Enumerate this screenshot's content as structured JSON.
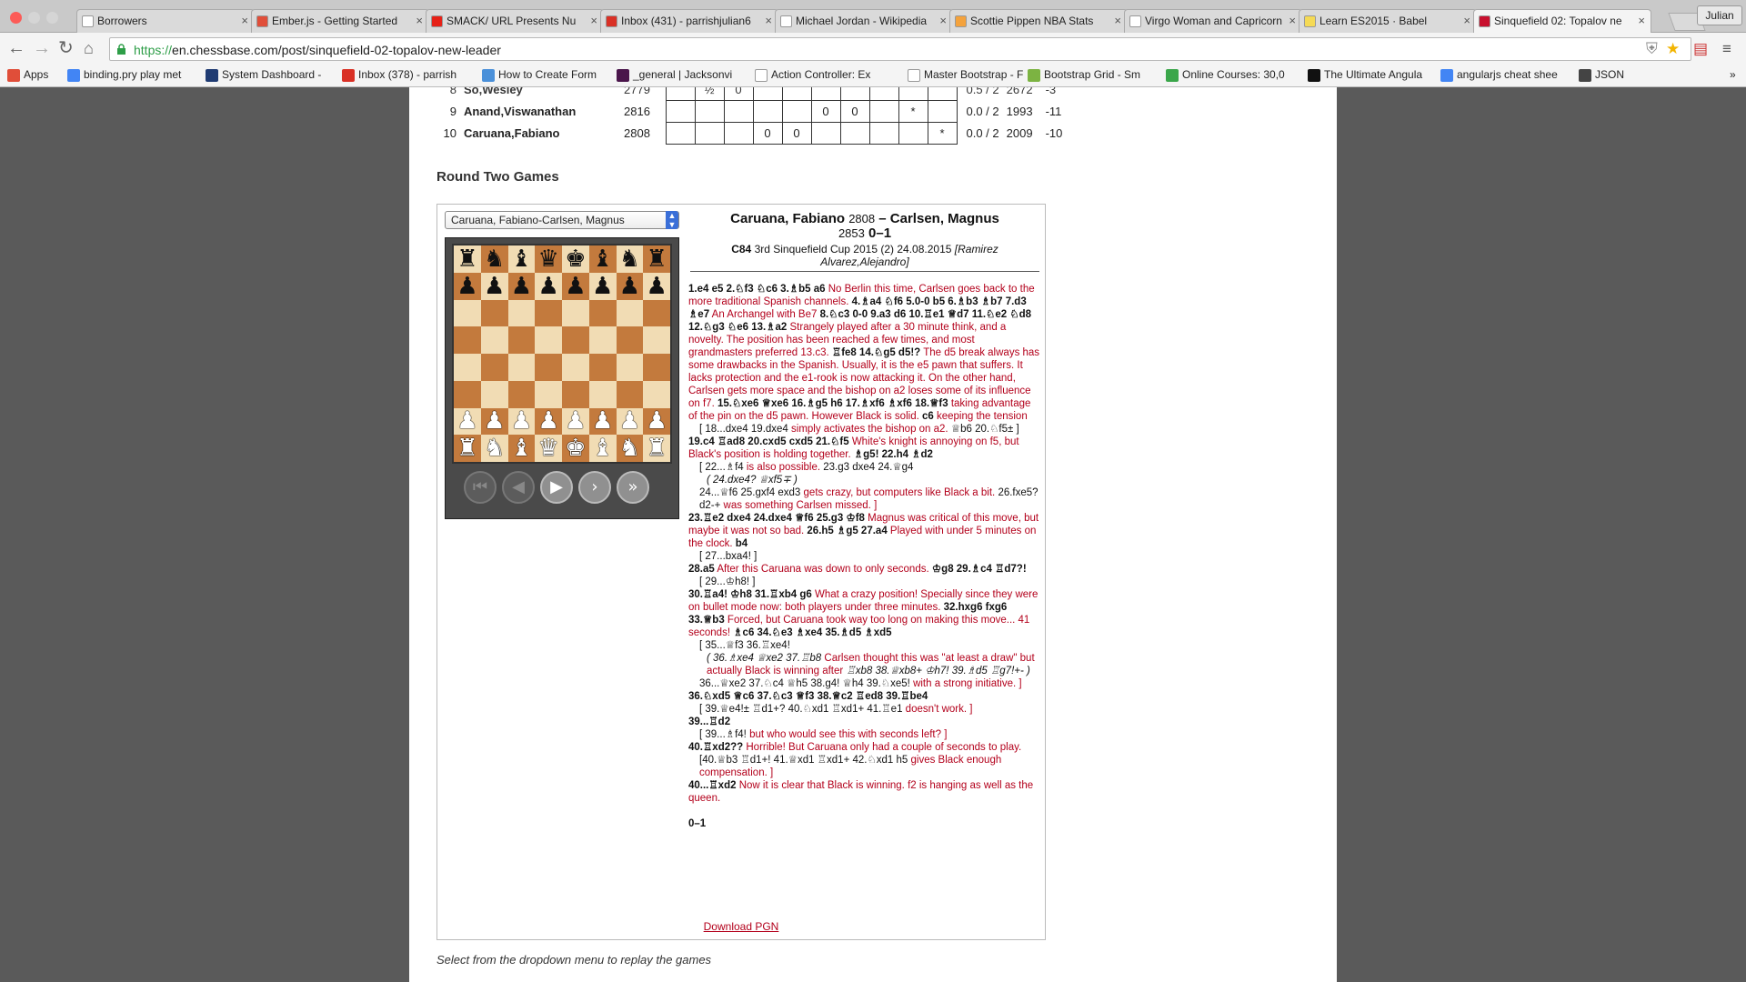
{
  "browser": {
    "tabs": [
      {
        "title": "Borrowers",
        "color": "#ffffff",
        "icon": "document-icon"
      },
      {
        "title": "Ember.js - Getting Started",
        "color": "#e04e39",
        "icon": "ember-icon"
      },
      {
        "title": "SMACK/ URL Presents Nu",
        "color": "#e62117",
        "icon": "youtube-icon"
      },
      {
        "title": "Inbox (431) - parrishjulian6",
        "color": "#d93025",
        "icon": "gmail-icon"
      },
      {
        "title": "Michael Jordan - Wikipedia",
        "color": "#ffffff",
        "icon": "wikipedia-icon"
      },
      {
        "title": "Scottie Pippen NBA Stats",
        "color": "#f4a23c",
        "icon": "basketball-icon"
      },
      {
        "title": "Virgo Woman and Capricorn",
        "color": "#ffffff",
        "icon": "document-icon"
      },
      {
        "title": "Learn ES2015 · Babel",
        "color": "#f5da55",
        "icon": "babel-icon"
      },
      {
        "title": "Sinquefield 02: Topalov ne",
        "color": "#c8102e",
        "icon": "chessbase-icon",
        "active": true
      }
    ],
    "profile_name": "Julian",
    "url_prefix": "https://",
    "url_rest": "en.chessbase.com/post/sinquefield-02-topalov-new-leader",
    "bookmarks": [
      {
        "label": "Apps",
        "color": "#e04e39",
        "icon": "apps-grid-icon"
      },
      {
        "label": "binding.pry play met",
        "color": "#4285f4",
        "icon": "google-icon"
      },
      {
        "label": "System Dashboard -",
        "color": "#1f3b73",
        "icon": "jira-icon"
      },
      {
        "label": "Inbox (378) - parrish",
        "color": "#d93025",
        "icon": "gmail-icon"
      },
      {
        "label": "How to Create Form",
        "color": "#4a90d9",
        "icon": "tutorial-icon"
      },
      {
        "label": "_general | Jacksonvi",
        "color": "#4a154b",
        "icon": "slack-icon"
      },
      {
        "label": "Action Controller: Ex",
        "color": "#ffffff",
        "icon": "document-icon"
      },
      {
        "label": "Master Bootstrap - F",
        "color": "#ffffff",
        "icon": "blank-icon"
      },
      {
        "label": "Bootstrap Grid - Sm",
        "color": "#7cb342",
        "icon": "grid-icon"
      },
      {
        "label": "Online Courses: 30,0",
        "color": "#3aa64a",
        "icon": "udemy-icon"
      },
      {
        "label": "The Ultimate Angula",
        "color": "#111111",
        "icon": "angular-icon"
      },
      {
        "label": "angularjs cheat shee",
        "color": "#4285f4",
        "icon": "google-icon"
      },
      {
        "label": "JSON",
        "color": "#444444",
        "icon": "json-icon"
      }
    ],
    "bookmarks_overflow": "»"
  },
  "standings": {
    "rows": [
      {
        "num": "8",
        "player": "So,Wesley",
        "elo": "2779",
        "cells": [
          "",
          "½",
          "0",
          "",
          "",
          "",
          "",
          "",
          "",
          ""
        ],
        "score": "0.5 / 2",
        "perf": "2672",
        "diff": "-3",
        "partial": true
      },
      {
        "num": "9",
        "player": "Anand,Viswanathan",
        "elo": "2816",
        "cells": [
          "",
          "",
          "",
          "",
          "",
          "0",
          "0",
          "",
          "*",
          ""
        ],
        "score": "0.0 / 2",
        "perf": "1993",
        "diff": "-11"
      },
      {
        "num": "10",
        "player": "Caruana,Fabiano",
        "elo": "2808",
        "cells": [
          "",
          "",
          "",
          "0",
          "0",
          "",
          "",
          "",
          "",
          "*"
        ],
        "score": "0.0 / 2",
        "perf": "2009",
        "diff": "-10"
      }
    ]
  },
  "section_title": "Round Two Games",
  "game": {
    "selector_value": "Caruana, Fabiano-Carlsen, Magnus",
    "white": "Caruana, Fabiano",
    "white_elo": "2808",
    "separator": "–",
    "black": "Carlsen, Magnus",
    "black_elo": "2853",
    "result": "0–1",
    "eco": "C84",
    "event": "3rd Sinquefield Cup 2015",
    "round": "(2)",
    "date": "24.08.2015",
    "annotator": "[Ramirez Alvarez,Alejandro]",
    "board": [
      [
        "♜",
        "♞",
        "♝",
        "♛",
        "♚",
        "♝",
        "♞",
        "♜"
      ],
      [
        "♟",
        "♟",
        "♟",
        "♟",
        "♟",
        "♟",
        "♟",
        "♟"
      ],
      [
        "",
        "",
        "",
        "",
        "",
        "",
        "",
        ""
      ],
      [
        "",
        "",
        "",
        "",
        "",
        "",
        "",
        ""
      ],
      [
        "",
        "",
        "",
        "",
        "",
        "",
        "",
        ""
      ],
      [
        "",
        "",
        "",
        "",
        "",
        "",
        "",
        ""
      ],
      [
        "♙",
        "♙",
        "♙",
        "♙",
        "♙",
        "♙",
        "♙",
        "♙"
      ],
      [
        "♖",
        "♘",
        "♗",
        "♕",
        "♔",
        "♗",
        "♘",
        "♖"
      ]
    ],
    "controls": [
      "|◀",
      "◀",
      "▶",
      "▶",
      "▶|"
    ],
    "download_label": "Download PGN",
    "final_result": "0–1"
  },
  "notation": [
    {
      "m": "1.e4  e5  2.♘f3  ♘c6  3.♗b5  a6",
      "c": " No Berlin this time, Carlsen goes back to the more traditional Spanish channels. ",
      "m2": "4.♗a4  ♘f6  5.0-0  b5  6.♗b3  ♗b7  7.d3  ♗e7",
      "c2": " An Archangel with Be7 ",
      "m3": "8.♘c3  0-0  9.a3  d6  10.♖e1  ♕d7  11.♘e2  ♘d8  12.♘g3  ♘e6  13.♗a2",
      "c3": " Strangely played after a 30 minute think, and a novelty. The position has been reached a few times, and most grandmasters preferred 13.c3. ",
      "m4": "♖fe8  14.♘g5  d5!?",
      "c4": " The d5 break always has some drawbacks in the Spanish. Usually, it is the e5 pawn that suffers. It lacks protection and the e1-rook is now attacking it. On the other hand, Carlsen gets more space and the bishop on a2 loses some of its influence on f7. ",
      "m5": "15.♘xe6  ♕xe6  16.♗g5  h6  17.♗xf6  ♗xf6  18.♕f3",
      "c5": " taking advantage of the pin on the d5 pawn. However Black is solid. ",
      "m6": "c6",
      "c6": " keeping the tension"
    },
    {
      "var": "[ 18...dxe4  19.dxe4 ",
      "vc": " simply activates the bishop on a2. ",
      "var2": " ♕b6  20.♘f5± ]"
    },
    {
      "m": "19.c4  ♖ad8  20.cxd5  cxd5  21.♘f5",
      "c": " White's knight is annoying on f5, but Black's position is holding together. ",
      "m2": "♗g5!  22.h4  ♗d2",
      "c2": "",
      "m3": "",
      "c3": "",
      "m4": "",
      "c4": "",
      "m5": "",
      "c5": "",
      "m6": "",
      "c6": ""
    },
    {
      "var": "[ 22...♗f4 ",
      "vc": " is also possible. ",
      "var2": " 23.g3  dxe4  24.♕g4"
    },
    {
      "sub": "( 24.dxe4?  ♕xf5∓ )"
    },
    {
      "var": "24...♕f6  25.gxf4  exd3 ",
      "vc": " gets crazy, but computers like Black a bit. ",
      "var2": " 26.fxe5?  d2-+",
      "vc2": " was something Carlsen missed. ]"
    },
    {
      "m": "23.♖e2  dxe4  24.dxe4  ♕f6  25.g3  ♔f8",
      "c": " Magnus was critical of this move, but maybe it was not so bad. ",
      "m2": "26.h5  ♗g5  27.a4",
      "c2": " Played with under 5 minutes on the clock. ",
      "m3": "b4",
      "c3": "",
      "m4": "",
      "c4": "",
      "m5": "",
      "c5": "",
      "m6": "",
      "c6": ""
    },
    {
      "var": "[ 27...bxa4! ]",
      "vc": "",
      "var2": ""
    },
    {
      "m": "28.a5",
      "c": " After this Caruana was down to only seconds. ",
      "m2": "♔g8  29.♗c4  ♖d7?!",
      "c2": "",
      "m3": "",
      "c3": "",
      "m4": "",
      "c4": "",
      "m5": "",
      "c5": "",
      "m6": "",
      "c6": ""
    },
    {
      "var": "[ 29...♔h8! ]",
      "vc": "",
      "var2": ""
    },
    {
      "m": "30.♖a4!  ♔h8  31.♖xb4  g6",
      "c": " What a crazy position! Specially since they were on bullet mode now: both players under three minutes. ",
      "m2": "32.hxg6  fxg6  33.♕b3",
      "c2": " Forced, but Caruana took way too long on making this move... 41 seconds! ",
      "m3": "♗c6  34.♘e3  ♗xe4  35.♗d5  ♗xd5",
      "c3": "",
      "m4": "",
      "c4": "",
      "m5": "",
      "c5": "",
      "m6": "",
      "c6": ""
    },
    {
      "var": "[ 35...♕f3  36.♖xe4!",
      "vc": "",
      "var2": ""
    },
    {
      "sub": "( 36.♗xe4  ♕xe2  37.♖b8 ",
      "subc": " Carlsen thought this was \"at least a draw\" but actually Black is winning after ",
      "sub2": " ♖xb8  38.♕xb8+  ♔h7!  39.♗d5  ♖g7!+- )"
    },
    {
      "var": "36...♕xe2  37.♘c4  ♕h5  38.g4!  ♕h4  39.♘xe5! ",
      "vc": " with a strong initiative. ]",
      "var2": ""
    },
    {
      "m": "36.♘xd5  ♕c6  37.♘c3  ♕f3  38.♕c2  ♖ed8  39.♖be4",
      "c": "",
      "m2": "",
      "c2": "",
      "m3": "",
      "c3": "",
      "m4": "",
      "c4": "",
      "m5": "",
      "c5": "",
      "m6": "",
      "c6": ""
    },
    {
      "var": "[ 39.♕e4!±  ♖d1+?  40.♘xd1  ♖xd1+  41.♖e1 ",
      "vc": " doesn't work. ]",
      "var2": ""
    },
    {
      "m": "39...♖d2",
      "c": "",
      "m2": "",
      "c2": "",
      "m3": "",
      "c3": "",
      "m4": "",
      "c4": "",
      "m5": "",
      "c5": "",
      "m6": "",
      "c6": ""
    },
    {
      "var": "[ 39...♗f4! ",
      "vc": " but who would see this with seconds left? ]",
      "var2": ""
    },
    {
      "m": "40.♖xd2??",
      "c": " Horrible! But Caruana only had a couple of seconds to play.",
      "m2": "",
      "c2": "",
      "m3": "",
      "c3": "",
      "m4": "",
      "c4": "",
      "m5": "",
      "c5": "",
      "m6": "",
      "c6": ""
    },
    {
      "var": "[40.♕b3  ♖d1+!  41.♕xd1  ♖xd1+  42.♘xd1  h5 ",
      "vc": " gives Black enough compensation. ]",
      "var2": ""
    },
    {
      "m": "40...♖xd2",
      "c": " Now it is clear that Black is winning. f2 is hanging as well as the queen.",
      "m2": "",
      "c2": "",
      "m3": "",
      "c3": "",
      "m4": "",
      "c4": "",
      "m5": "",
      "c5": "",
      "m6": "",
      "c6": ""
    }
  ],
  "caption": "Select from the dropdown menu to replay the games",
  "colors": {
    "accent_red": "#b3001b",
    "board_light": "#f1dcb4",
    "board_dark": "#c37a3d"
  }
}
